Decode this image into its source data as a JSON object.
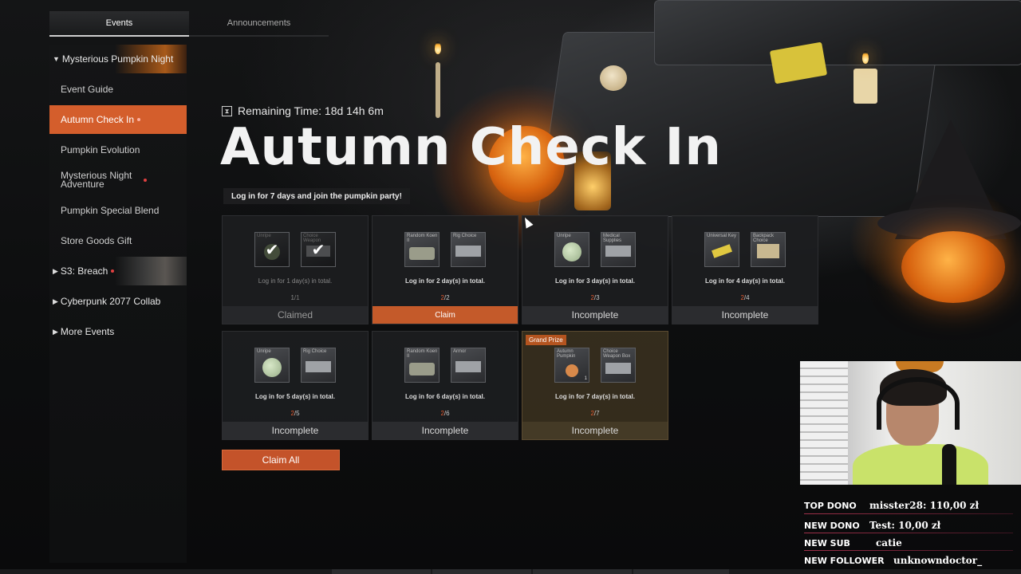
{
  "tabs": [
    {
      "label": "Events",
      "active": true
    },
    {
      "label": "Announcements",
      "active": false
    }
  ],
  "sidebar": {
    "groups": [
      {
        "label": "Mysterious Pumpkin Night",
        "expanded": true
      },
      {
        "label": "S3: Breach",
        "expanded": false
      },
      {
        "label": "Cyberpunk 2077 Collab",
        "expanded": false
      },
      {
        "label": "More Events",
        "expanded": false
      }
    ],
    "items": [
      {
        "label": "Event Guide"
      },
      {
        "label": "Autumn Check In",
        "active": true
      },
      {
        "label": "Pumpkin Evolution"
      },
      {
        "label": "Mysterious Night Adventure"
      },
      {
        "label": "Pumpkin Special Blend"
      },
      {
        "label": "Store Goods Gift"
      }
    ]
  },
  "event": {
    "remaining": "Remaining Time: 18d 14h 6m",
    "title": "Autumn Check In",
    "subtitle": "Log in for 7 days and join the pumpkin party!"
  },
  "cards": [
    {
      "items": [
        {
          "name": "Unripe"
        },
        {
          "name": "Choice Weapon"
        }
      ],
      "desc": "Log in for 1 day(s) in total.",
      "current": "1",
      "total": "/1",
      "status": "Claimed"
    },
    {
      "items": [
        {
          "name": "Random Koen II"
        },
        {
          "name": "Rig Choice"
        }
      ],
      "desc": "Log in for 2 day(s) in total.",
      "current": "2",
      "total": "/2",
      "status": "Claim"
    },
    {
      "items": [
        {
          "name": "Unripe"
        },
        {
          "name": "Medical Supplies"
        }
      ],
      "desc": "Log in for 3 day(s) in total.",
      "current": "2",
      "total": "/3",
      "status": "Incomplete"
    },
    {
      "items": [
        {
          "name": "Universal Key"
        },
        {
          "name": "Backpack Choice"
        }
      ],
      "desc": "Log in for 4 day(s) in total.",
      "current": "2",
      "total": "/4",
      "status": "Incomplete"
    },
    {
      "items": [
        {
          "name": "Unripe"
        },
        {
          "name": "Rig Choice"
        }
      ],
      "desc": "Log in for 5 day(s) in total.",
      "current": "2",
      "total": "/5",
      "status": "Incomplete"
    },
    {
      "items": [
        {
          "name": "Random Koen II"
        },
        {
          "name": "Armor"
        }
      ],
      "desc": "Log in for 6 day(s) in total.",
      "current": "2",
      "total": "/6",
      "status": "Incomplete"
    },
    {
      "badge": "Grand Prize",
      "items": [
        {
          "name": "Autumn Pumpkin",
          "qty": "1"
        },
        {
          "name": "Choice Weapon Box"
        }
      ],
      "desc": "Log in for 7 day(s) in total.",
      "current": "2",
      "total": "/7",
      "status": "Incomplete"
    }
  ],
  "claim_all": "Claim All",
  "stream": {
    "top_dono": {
      "label": "TOP DONO",
      "value": "misster28: 110,00 zł"
    },
    "new_dono": {
      "label": "NEW DONO",
      "value": "Test: 10,00 zł"
    },
    "new_sub": {
      "label": "NEW SUB",
      "value": "catie"
    },
    "new_follower": {
      "label": "NEW FOLLOWER",
      "value": "unknowndoctor_"
    }
  },
  "colors": {
    "accent": "#d45e2c",
    "claim": "#c45a2a",
    "progress_current": "#e05a30"
  }
}
